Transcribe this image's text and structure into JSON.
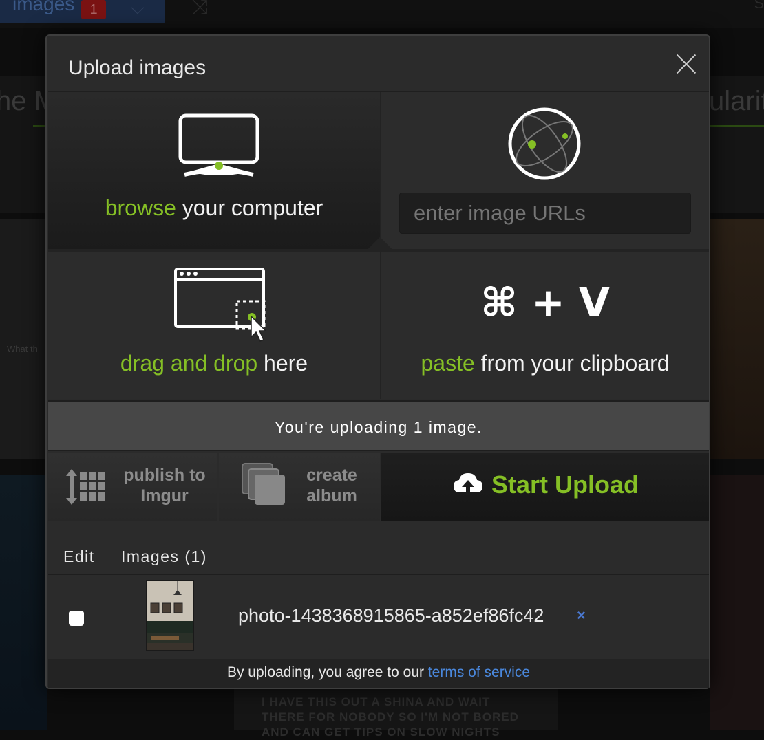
{
  "background": {
    "tab_label": "images",
    "tab_badge": "1",
    "heading_left_fragment": "he M",
    "heading_right_fragment": "ularity",
    "left_caption": "What th",
    "bottom_text": "I HAVE THIS OUT A SHINA AND WAIT THERE FOR NOBODY SO I'M NOT BORED AND CAN GET TIPS ON SLOW NIGHTS",
    "right_edge_letter": "S"
  },
  "modal": {
    "title": "Upload images",
    "close_icon": "close-icon"
  },
  "browse": {
    "icon": "monitor-icon",
    "highlight": "browse",
    "rest": " your computer"
  },
  "url": {
    "icon": "globe-icon",
    "placeholder": "enter image URLs"
  },
  "drag": {
    "icon": "browser-window-cursor-icon",
    "highlight": "drag and drop",
    "rest": " here"
  },
  "paste": {
    "keys": "⌘ + V",
    "highlight": "paste",
    "rest": " from your clipboard"
  },
  "status": {
    "text": "You're uploading 1 image."
  },
  "actions": {
    "publish_line1": "publish to",
    "publish_line2": "Imgur",
    "album_line1": "create",
    "album_line2": "album",
    "start_label": "Start Upload"
  },
  "list": {
    "col_edit": "Edit",
    "col_images": "Images (1)",
    "items": [
      {
        "filename": "photo-1438368915865-a852ef86fc42",
        "remove_label": "×",
        "checked": false
      }
    ]
  },
  "footer": {
    "prefix": "By uploading, you agree to our ",
    "link": "terms of service"
  },
  "colors": {
    "accent_green": "#85bf25",
    "link_blue": "#4a88dd",
    "modal_bg": "#2b2b2b"
  }
}
